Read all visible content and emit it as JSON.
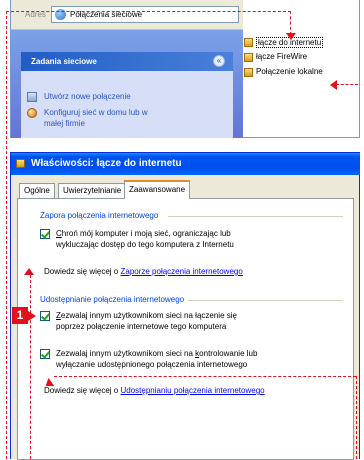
{
  "explorer": {
    "address_label": "Adres",
    "address_value": "Połączenia sieciowe",
    "tasks_title": "Zadania sieciowe",
    "collapse_glyph": "«",
    "tasks": [
      {
        "label": "Utwórz nowe połączenie",
        "icon": "new-connection-icon"
      },
      {
        "label_line1": "Konfiguruj sieć w domu lub w",
        "label_line2": "małej firmie",
        "icon": "home-network-icon"
      }
    ],
    "connections": [
      {
        "label": "łącze do internetu",
        "icon": "connection-icon",
        "selected": true
      },
      {
        "label": "łącze FireWire",
        "icon": "connection-icon",
        "selected": false
      },
      {
        "label": "Połączenie lokalne",
        "icon": "connection-icon",
        "selected": false
      }
    ]
  },
  "dialog": {
    "title": "Właściwości: łącze do internetu",
    "tabs": [
      {
        "label": "Ogólne",
        "active": false
      },
      {
        "label": "Uwierzytelnianie",
        "active": false
      },
      {
        "label": "Zaawansowane",
        "active": true
      }
    ],
    "firewall_group": {
      "title": "Zapora połączenia internetowego",
      "checkbox_line1_pre": "",
      "checkbox_line1_u": "C",
      "checkbox_line1_post": "hroń mój komputer i moją sieć, ograniczając lub",
      "checkbox_line2": "wykluczając dostęp do tego komputera z Internetu",
      "checked": true,
      "info_prefix": "Dowiedz się więcej o ",
      "info_link": "Zaporze połączenia internetowego"
    },
    "sharing_group": {
      "title": "Udostępnianie połączenia internetowego",
      "checkbox1_line1_pre": "",
      "checkbox1_line1_u": "Z",
      "checkbox1_line1_post": "ezwalaj innym użytkownikom sieci na łączenie się",
      "checkbox1_line2": "poprzez połączenie internetowe tego komputera",
      "checkbox1_checked": true,
      "checkbox2_line1_pre": "Zezwalaj innym użytkownikom sieci na ",
      "checkbox2_line1_u": "k",
      "checkbox2_line1_post": "ontrolowanie lub",
      "checkbox2_line2": "wyłączanie udostępnionego połączenia internetowego",
      "checkbox2_checked": true,
      "info_prefix": "Dowiedz się więcej o ",
      "info_link": "Udostępnianiu połączenia internetowego"
    }
  },
  "annotations": {
    "step_badge": "1",
    "color": "#e3101c"
  }
}
